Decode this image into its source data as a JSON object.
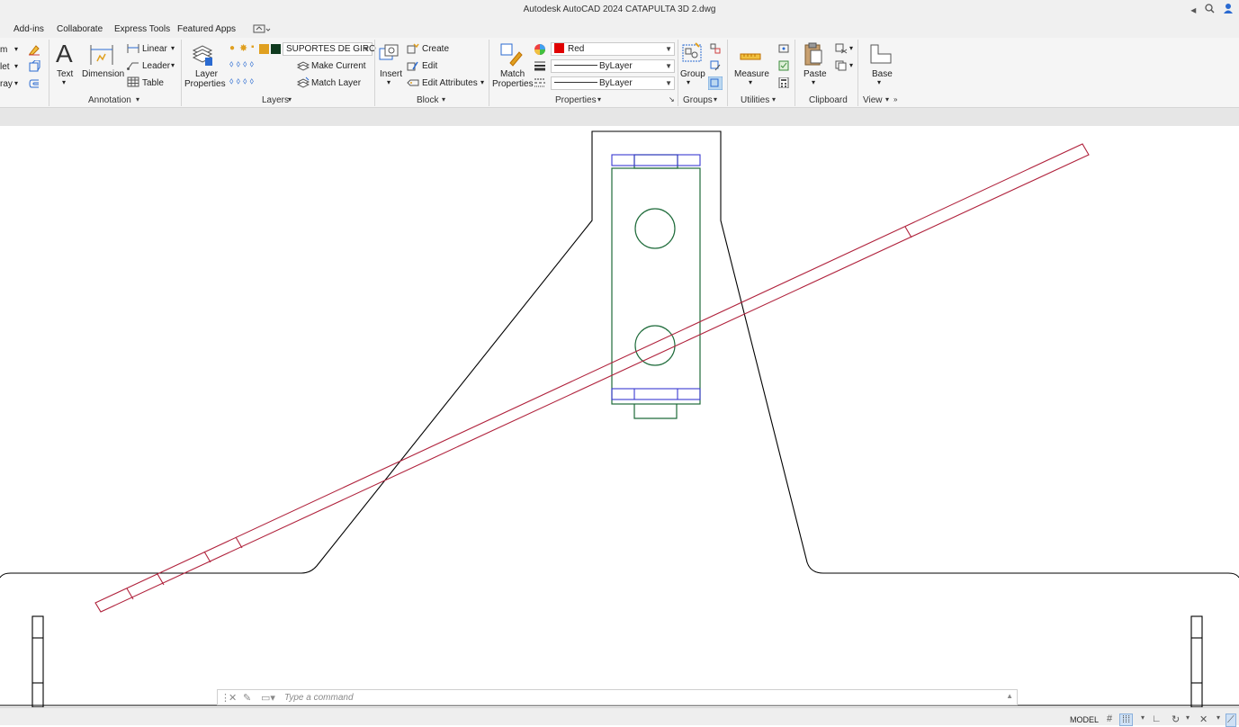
{
  "window": {
    "title": "Autodesk AutoCAD 2024    CATAPULTA 3D 2.dwg"
  },
  "menu": [
    "Add-ins",
    "Collaborate",
    "Express Tools",
    "Featured Apps"
  ],
  "ribbon": {
    "modify_partial": [
      "m",
      "let",
      "ray"
    ],
    "annotation": {
      "text": "Text",
      "dimension": "Dimension",
      "linear": "Linear",
      "leader": "Leader",
      "table": "Table",
      "title": "Annotation"
    },
    "layers": {
      "layer_properties_1": "Layer",
      "layer_properties_2": "Properties",
      "current_layer": "SUPORTES DE GIRO",
      "make_current": "Make Current",
      "match_layer": "Match Layer",
      "title": "Layers"
    },
    "block": {
      "insert": "Insert",
      "create": "Create",
      "edit": "Edit",
      "edit_attributes": "Edit Attributes",
      "title": "Block"
    },
    "properties": {
      "match_1": "Match",
      "match_2": "Properties",
      "color": "Red",
      "linetype": "ByLayer",
      "lineweight": "ByLayer",
      "title": "Properties"
    },
    "groups": {
      "group": "Group",
      "title": "Groups"
    },
    "utilities": {
      "measure": "Measure",
      "title": "Utilities"
    },
    "clipboard": {
      "paste": "Paste",
      "title": "Clipboard"
    },
    "view": {
      "base": "Base",
      "title": "View"
    }
  },
  "command": {
    "placeholder": "Type a command"
  },
  "status": {
    "model": "MODEL"
  },
  "colors": {
    "red_swatch": "#e00000",
    "layer_swatch": "#0f3a1e",
    "drawing_black": "#000000",
    "drawing_green": "#1e6b3a",
    "drawing_blue": "#3a3ad1",
    "drawing_red": "#b0223c"
  }
}
